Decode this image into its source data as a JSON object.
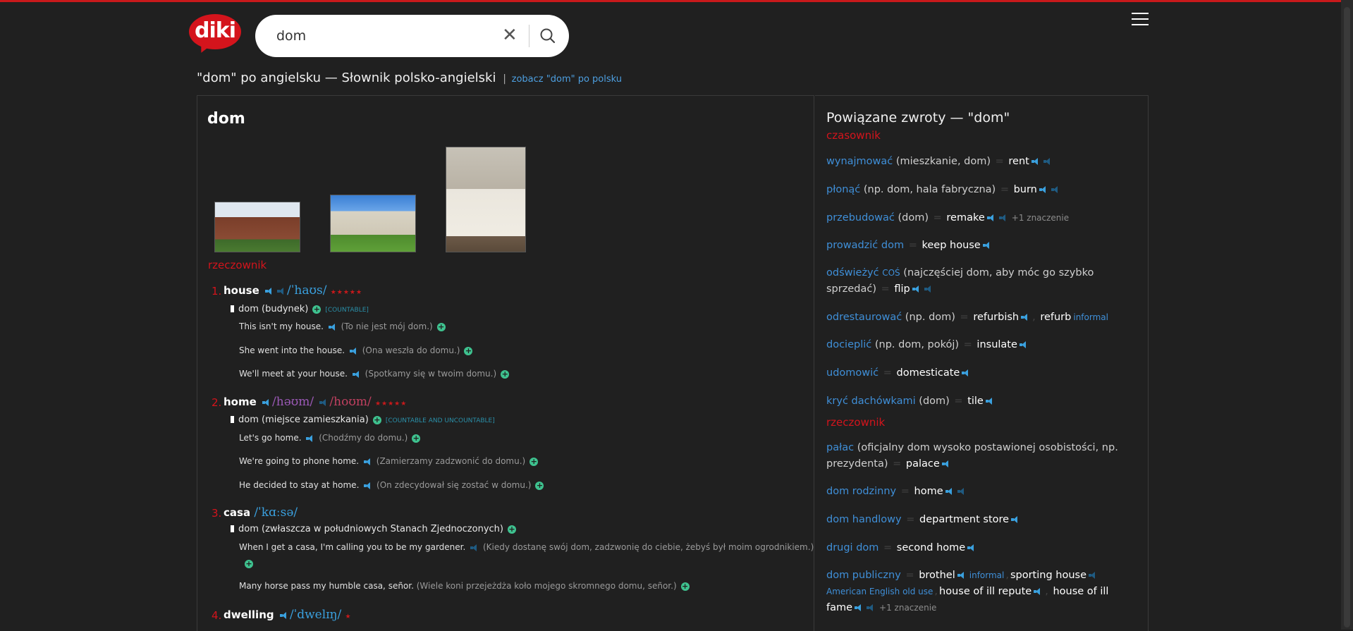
{
  "header": {
    "logo_text": "diki",
    "search_value": "dom",
    "clear_glyph": "✕"
  },
  "page_title": {
    "main": "\"dom\" po angielsku — Słownik polsko-angielski",
    "pipe": "|",
    "link": "zobacz \"dom\" po polsku"
  },
  "headword": "dom",
  "pos_noun": "rzeczownik",
  "entries": [
    {
      "num": "1.",
      "word": "house",
      "ipa1": "/ˈhaʊs/",
      "stars": "★★★★★",
      "meaning": "dom (budynek)",
      "gram": "[COUNTABLE]",
      "examples": [
        {
          "en": "This isn't my house.",
          "pl": "(To nie jest mój dom.)"
        },
        {
          "en": "She went into the house.",
          "pl": "(Ona weszła do domu.)"
        },
        {
          "en": "We'll meet at your house.",
          "pl": "(Spotkamy się w twoim domu.)"
        }
      ]
    },
    {
      "num": "2.",
      "word": "home",
      "ipa1": "/həʊm/",
      "ipa2": "/hoʊm/",
      "stars": "★★★★★",
      "meaning": "dom (miejsce zamieszkania)",
      "gram": "[COUNTABLE AND UNCOUNTABLE]",
      "examples": [
        {
          "en": "Let's go home.",
          "pl": "(Chodźmy do domu.)"
        },
        {
          "en": "We're going to phone home.",
          "pl": "(Zamierzamy zadzwonić do domu.)"
        },
        {
          "en": "He decided to stay at home.",
          "pl": "(On zdecydował się zostać w domu.)"
        }
      ]
    },
    {
      "num": "3.",
      "word": "casa",
      "ipa1": "/ˈkɑːsə/",
      "meaning": "dom (zwłaszcza w południowych Stanach Zjednoczonych)",
      "examples": [
        {
          "en": "When I get a casa, I'm calling you to be my gardener.",
          "pl": "(Kiedy dostanę swój dom, zadzwonię do ciebie, żebyś był moim ogrodnikiem.)"
        },
        {
          "en": "Many horse pass my humble casa, señor.",
          "pl": "(Wiele koni przejeżdża koło mojego skromnego domu, señor.)"
        }
      ]
    },
    {
      "num": "4.",
      "word": "dwelling",
      "ipa1": "/ˈdwelɪŋ/",
      "stars": "★"
    }
  ],
  "related": {
    "title": "Powiązane zwroty — \"dom\"",
    "pos_verb": "czasownik",
    "pos_noun": "rzeczownik",
    "eq": "=",
    "verbs": [
      {
        "pl": "wynajmować",
        "ctx": "(mieszkanie, dom)",
        "en": "rent"
      },
      {
        "pl": "płonąć",
        "ctx": "(np. dom, hala fabryczna)",
        "en": "burn"
      },
      {
        "pl": "przebudować",
        "ctx": "(dom)",
        "en": "remake",
        "more": "+1 znaczenie"
      },
      {
        "pl": "prowadzić dom",
        "en": "keep house"
      },
      {
        "pl": "odświeżyć",
        "pl_small": "COŚ",
        "ctx": "(najczęściej dom, aby móc go szybko sprzedać)",
        "en": "flip"
      },
      {
        "pl": "odrestaurować",
        "ctx": "(np. dom)",
        "en": "refurbish",
        "en2": "refurb",
        "reg2": "informal"
      },
      {
        "pl": "docieplić",
        "ctx": "(np. dom, pokój)",
        "en": "insulate"
      },
      {
        "pl": "udomowić",
        "en": "domesticate"
      },
      {
        "pl": "kryć dachówkami",
        "ctx": "(dom)",
        "en": "tile"
      }
    ],
    "nouns": [
      {
        "pl": "pałac",
        "ctx": "(oficjalny dom wysoko postawionej osobistości, np. prezydenta)",
        "en": "palace"
      },
      {
        "pl": "dom rodzinny",
        "en": "home"
      },
      {
        "pl": "dom handlowy",
        "en": "department store"
      },
      {
        "pl": "drugi dom",
        "en": "second home"
      },
      {
        "pl": "dom publiczny",
        "en": "brothel",
        "reg2": "informal",
        "en2": "sporting house",
        "reg3": "American English old use",
        "en3": "house of ill repute",
        "en4": "house of ill fame",
        "more": "+1 znaczenie"
      }
    ]
  }
}
